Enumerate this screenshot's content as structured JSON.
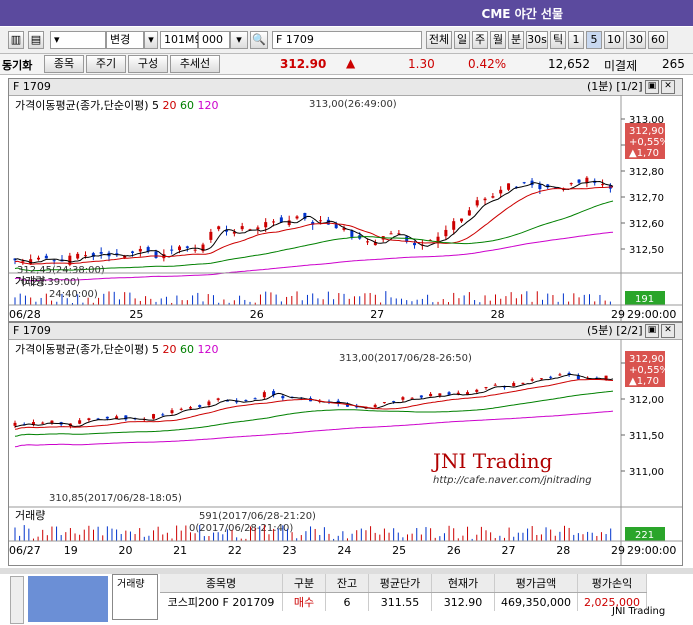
{
  "title_bar": {
    "title": "CME 야간 선물"
  },
  "toolbar": {
    "mode_label": "변경",
    "code": "101M9",
    "code_suffix": "000",
    "search_text": "F 1709",
    "buttons": [
      "전체",
      "일",
      "주",
      "월",
      "분",
      "30s",
      "틱",
      "1",
      "5",
      "10",
      "30",
      "60"
    ],
    "active_button": "5"
  },
  "quote_bar": {
    "label": "동기화",
    "tabs": [
      "종목",
      "주기",
      "구성",
      "추세선"
    ],
    "price": "312.90",
    "change": "1.30",
    "change_pct": "0.42%",
    "volume": "12,652",
    "unsettled_label": "미결제",
    "unsettled_value": "265"
  },
  "chart1": {
    "symbol": "F 1709",
    "period": "(1분) [1/2]",
    "ma_label": "가격이동평균(종가,단순이평)",
    "ma_periods": [
      "5",
      "20",
      "60",
      "120"
    ],
    "y_ticks": [
      "313,00",
      "312,90",
      "312,80",
      "312,70",
      "312,60",
      "312,50"
    ],
    "price_badge": [
      "312,90",
      "+0,55%",
      "▲1,70"
    ],
    "high_annot": "313,00(26:49:00)",
    "low_annot": "312,45(24:38:00)",
    "vol_label": "거래량",
    "vol_annot": "0(24:39:00)",
    "vol_annot2": "24:40:00)",
    "vol_badge": "191",
    "x_labels": [
      "06/28",
      "25",
      "26",
      "27",
      "28",
      "29",
      "29:00:00"
    ]
  },
  "chart2": {
    "symbol": "F 1709",
    "period": "(5분) [2/2]",
    "ma_label": "가격이동평균(종가,단순이평)",
    "ma_periods": [
      "5",
      "20",
      "60",
      "120"
    ],
    "y_ticks": [
      "312,50",
      "312,00",
      "311,50",
      "311,00"
    ],
    "price_badge": [
      "312,90",
      "+0,55%",
      "▲1,70"
    ],
    "high_annot": "313,00(2017/06/28-26:50)",
    "low_annot": "310,85(2017/06/28-18:05)",
    "watermark": "JNI Trading",
    "watermark_url": "http://cafe.naver.com/jnitrading",
    "vol_label": "거래량",
    "vol_annot": "591(2017/06/28-21:20)",
    "vol_annot2": "0(2017/06/28-21:40)",
    "vol_badge": "221",
    "x_labels": [
      "06/27",
      "19",
      "20",
      "21",
      "22",
      "23",
      "24",
      "25",
      "26",
      "27",
      "28",
      "29",
      "29:00:00"
    ]
  },
  "positions": {
    "side_label": "거래량",
    "headers": [
      "종목명",
      "구분",
      "잔고",
      "평균단가",
      "현재가",
      "평가금액",
      "평가손익"
    ],
    "row": [
      "코스피200 F 201709",
      "매수",
      "6",
      "311.55",
      "312.90",
      "469,350,000",
      "2,025,000"
    ],
    "footer": "JNI Trading"
  },
  "colors": {
    "ma5": "#000000",
    "ma20": "#cc0000",
    "ma60": "#008000",
    "ma120": "#cc00cc",
    "up": "#cc0000",
    "badge": "#d9534f",
    "vol_badge": "#2aa52a"
  }
}
